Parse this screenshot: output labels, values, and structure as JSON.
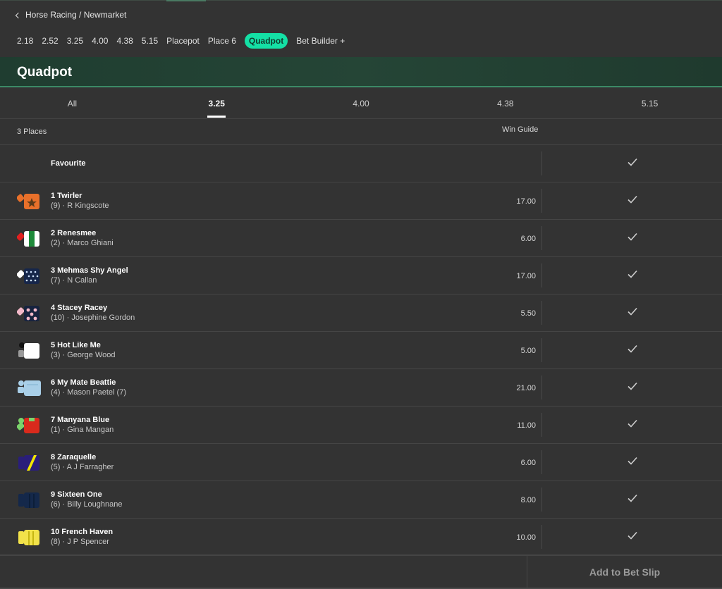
{
  "breadcrumb": {
    "text": "Horse Racing / Newmarket"
  },
  "race_nav": [
    {
      "label": "2.18",
      "active": false
    },
    {
      "label": "2.52",
      "active": false
    },
    {
      "label": "3.25",
      "active": false
    },
    {
      "label": "4.00",
      "active": false
    },
    {
      "label": "4.38",
      "active": false
    },
    {
      "label": "5.15",
      "active": false
    },
    {
      "label": "Placepot",
      "active": false
    },
    {
      "label": "Place 6",
      "active": false
    },
    {
      "label": "Quadpot",
      "active": true
    },
    {
      "label": "Bet Builder +",
      "active": false
    }
  ],
  "banner": {
    "title": "Quadpot"
  },
  "tabs": [
    {
      "label": "All",
      "active": false
    },
    {
      "label": "3.25",
      "active": true
    },
    {
      "label": "4.00",
      "active": false
    },
    {
      "label": "4.38",
      "active": false
    },
    {
      "label": "5.15",
      "active": false
    }
  ],
  "subheader": {
    "places": "3 Places",
    "guide": "Win Guide"
  },
  "favourite": {
    "label": "Favourite"
  },
  "runners": [
    {
      "name": "1 Twirler",
      "jockey": "(9) · R Kingscote",
      "price": "17.00",
      "silk": "orange-star"
    },
    {
      "name": "2 Renesmee",
      "jockey": "(2) · Marco Ghiani",
      "price": "6.00",
      "silk": "red-green-white"
    },
    {
      "name": "3 Mehmas Shy Angel",
      "jockey": "(7) · N Callan",
      "price": "17.00",
      "silk": "navy-spots"
    },
    {
      "name": "4 Stacey Racey",
      "jockey": "(10) · Josephine Gordon",
      "price": "5.50",
      "silk": "navy-pink-spots"
    },
    {
      "name": "5 Hot Like Me",
      "jockey": "(3) · George Wood",
      "price": "5.00",
      "silk": "white-black"
    },
    {
      "name": "6 My Mate Beattie",
      "jockey": "(4) · Mason Paetel (7)",
      "price": "21.00",
      "silk": "light-blue"
    },
    {
      "name": "7 Manyana Blue",
      "jockey": "(1) · Gina Mangan",
      "price": "11.00",
      "silk": "red-green"
    },
    {
      "name": "8 Zaraquelle",
      "jockey": "(5) · A J Farragher",
      "price": "6.00",
      "silk": "purple-yellow"
    },
    {
      "name": "9 Sixteen One",
      "jockey": "(6) · Billy Loughnane",
      "price": "8.00",
      "silk": "navy-stripes"
    },
    {
      "name": "10 French Haven",
      "jockey": "(8) · J P Spencer",
      "price": "10.00",
      "silk": "yellow-stripes"
    }
  ],
  "footer": {
    "button_label": "Add to Bet Slip"
  },
  "colors": {
    "accent": "#14e0a5",
    "background": "#333333",
    "banner": "#1f3d30"
  }
}
